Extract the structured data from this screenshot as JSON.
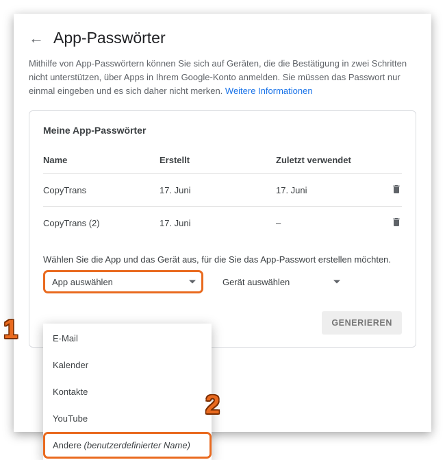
{
  "page": {
    "title": "App-Passwörter"
  },
  "description": {
    "text_1": "Mithilfe von App-Passwörtern können Sie sich auf Geräten, die die Bestätigung in zwei Schritten nicht unterstützen, über Apps in Ihrem Google-Konto anmelden. Sie müssen das Passwort nur einmal eingeben und es sich daher nicht merken. ",
    "link": "Weitere Informationen"
  },
  "card": {
    "header": "Meine App-Passwörter",
    "columns": {
      "name": "Name",
      "created": "Erstellt",
      "used": "Zuletzt verwendet"
    },
    "rows": [
      {
        "name": "CopyTrans",
        "created": "17. Juni",
        "used": "17. Juni"
      },
      {
        "name": "CopyTrans (2)",
        "created": "17. Juni",
        "used": "–"
      }
    ],
    "prompt": "Wählen Sie die App und das Gerät aus, für die Sie das App-Passwort erstellen möchten.",
    "app_select_label": "App auswählen",
    "device_select_label": "Gerät auswählen",
    "generate": "GENERIEREN"
  },
  "dropdown": {
    "items": [
      "E-Mail",
      "Kalender",
      "Kontakte",
      "YouTube"
    ],
    "other_prefix": "Andere ",
    "other_suffix": "(benutzerdefinierter Name)"
  },
  "markers": {
    "one": "1",
    "two": "2"
  }
}
